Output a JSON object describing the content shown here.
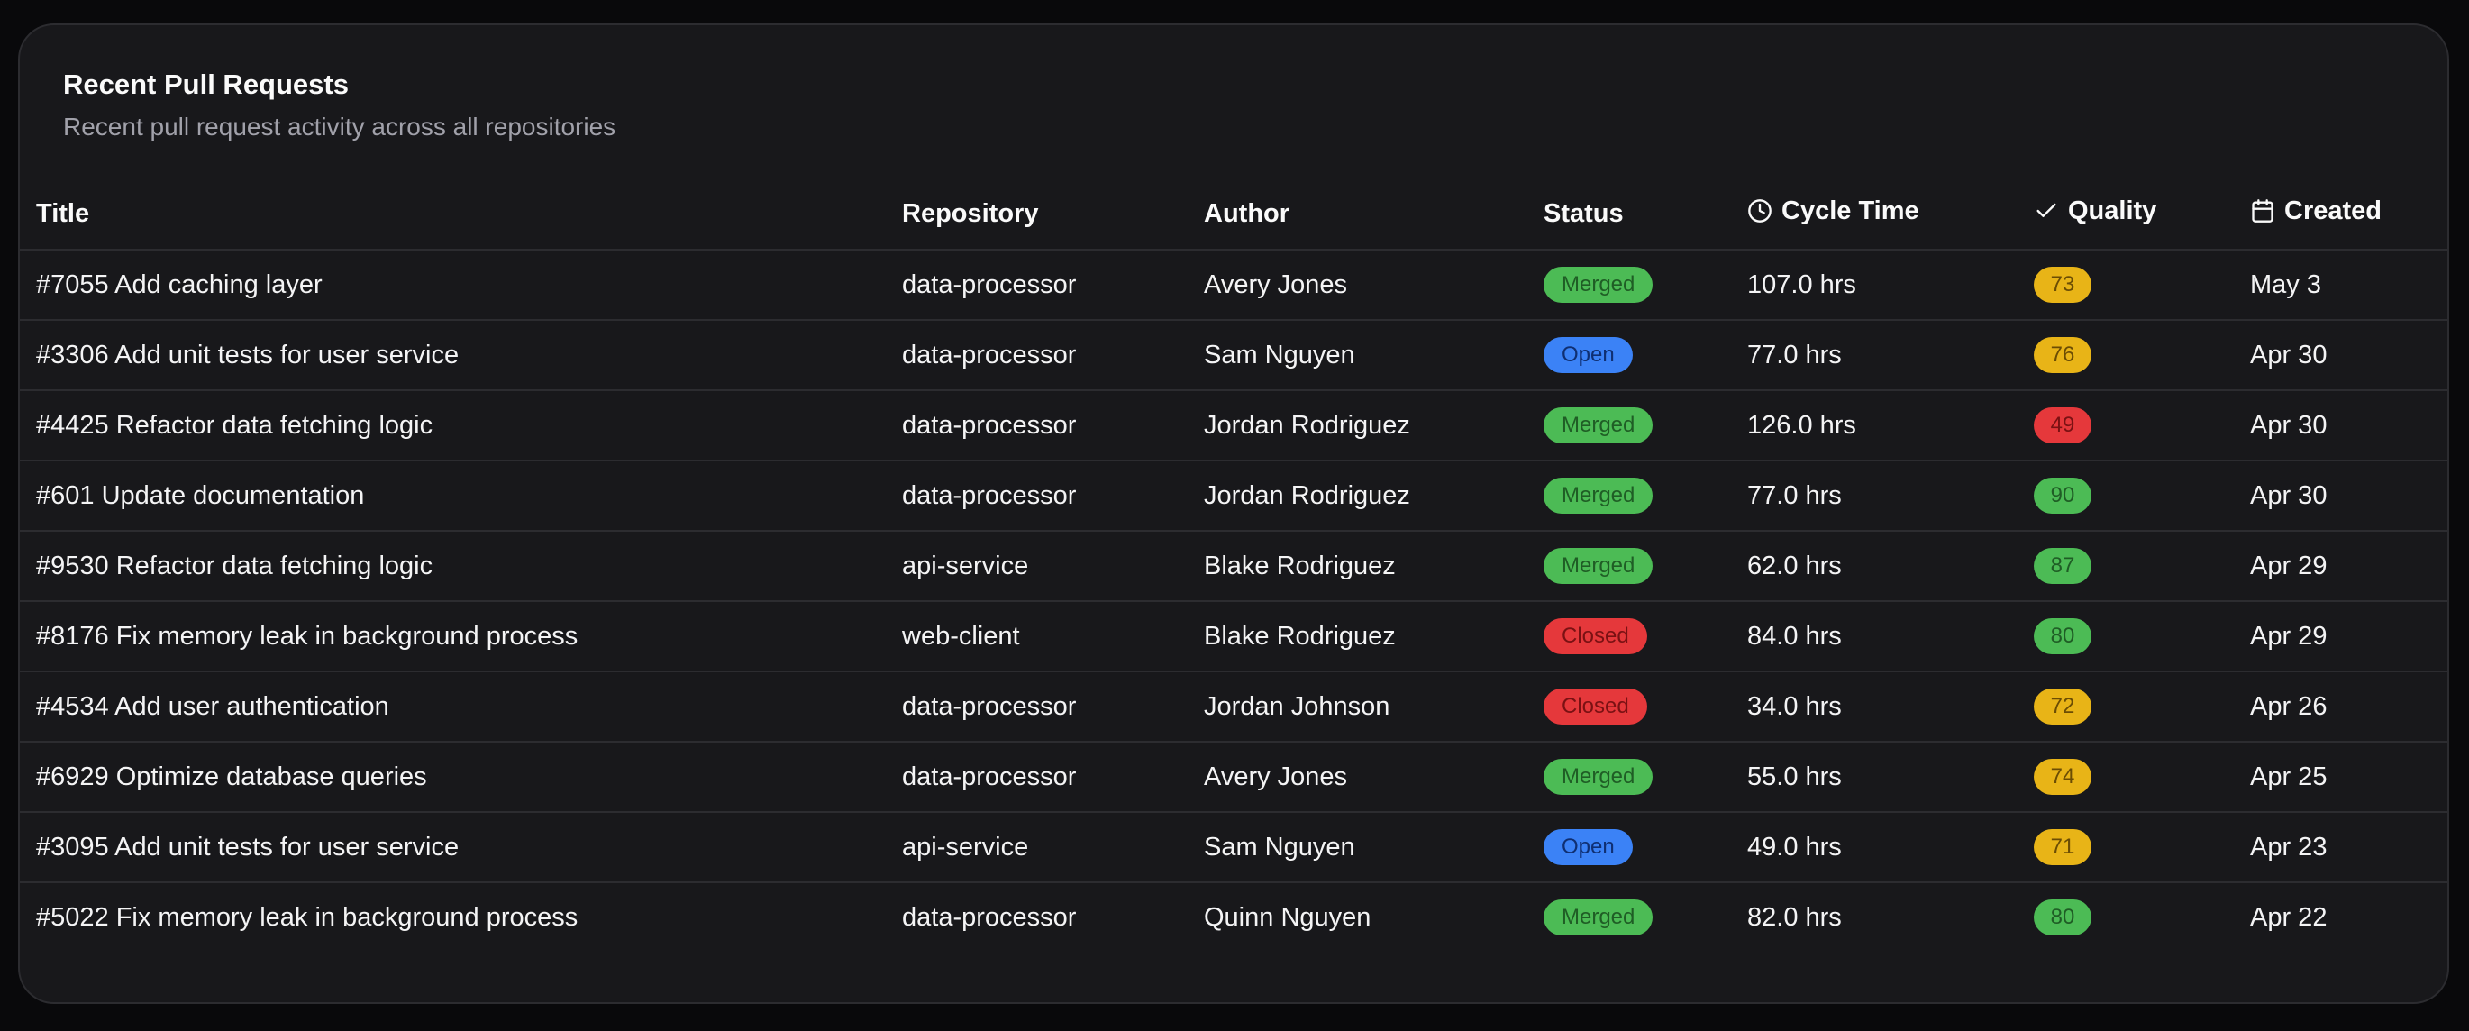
{
  "card": {
    "title": "Recent Pull Requests",
    "description": "Recent pull request activity across all repositories"
  },
  "columns": {
    "title": "Title",
    "repository": "Repository",
    "author": "Author",
    "status": "Status",
    "cycle_time": "Cycle Time",
    "quality": "Quality",
    "created": "Created"
  },
  "icons": {
    "cycle_time": "clock-icon",
    "quality": "check-icon",
    "created": "calendar-icon"
  },
  "colors": {
    "merged": "#4cbb55",
    "open": "#3b82f6",
    "closed": "#e5383b",
    "quality_high": "#4cbb55",
    "quality_mid": "#e8b417",
    "quality_low": "#e5383b"
  },
  "rows": [
    {
      "title": "#7055 Add caching layer",
      "repository": "data-processor",
      "author": "Avery Jones",
      "status": "Merged",
      "cycle_time": "107.0 hrs",
      "quality": "73",
      "created": "May 3"
    },
    {
      "title": "#3306 Add unit tests for user service",
      "repository": "data-processor",
      "author": "Sam Nguyen",
      "status": "Open",
      "cycle_time": "77.0 hrs",
      "quality": "76",
      "created": "Apr 30"
    },
    {
      "title": "#4425 Refactor data fetching logic",
      "repository": "data-processor",
      "author": "Jordan Rodriguez",
      "status": "Merged",
      "cycle_time": "126.0 hrs",
      "quality": "49",
      "created": "Apr 30"
    },
    {
      "title": "#601 Update documentation",
      "repository": "data-processor",
      "author": "Jordan Rodriguez",
      "status": "Merged",
      "cycle_time": "77.0 hrs",
      "quality": "90",
      "created": "Apr 30"
    },
    {
      "title": "#9530 Refactor data fetching logic",
      "repository": "api-service",
      "author": "Blake Rodriguez",
      "status": "Merged",
      "cycle_time": "62.0 hrs",
      "quality": "87",
      "created": "Apr 29"
    },
    {
      "title": "#8176 Fix memory leak in background process",
      "repository": "web-client",
      "author": "Blake Rodriguez",
      "status": "Closed",
      "cycle_time": "84.0 hrs",
      "quality": "80",
      "created": "Apr 29"
    },
    {
      "title": "#4534 Add user authentication",
      "repository": "data-processor",
      "author": "Jordan Johnson",
      "status": "Closed",
      "cycle_time": "34.0 hrs",
      "quality": "72",
      "created": "Apr 26"
    },
    {
      "title": "#6929 Optimize database queries",
      "repository": "data-processor",
      "author": "Avery Jones",
      "status": "Merged",
      "cycle_time": "55.0 hrs",
      "quality": "74",
      "created": "Apr 25"
    },
    {
      "title": "#3095 Add unit tests for user service",
      "repository": "api-service",
      "author": "Sam Nguyen",
      "status": "Open",
      "cycle_time": "49.0 hrs",
      "quality": "71",
      "created": "Apr 23"
    },
    {
      "title": "#5022 Fix memory leak in background process",
      "repository": "data-processor",
      "author": "Quinn Nguyen",
      "status": "Merged",
      "cycle_time": "82.0 hrs",
      "quality": "80",
      "created": "Apr 22"
    }
  ]
}
